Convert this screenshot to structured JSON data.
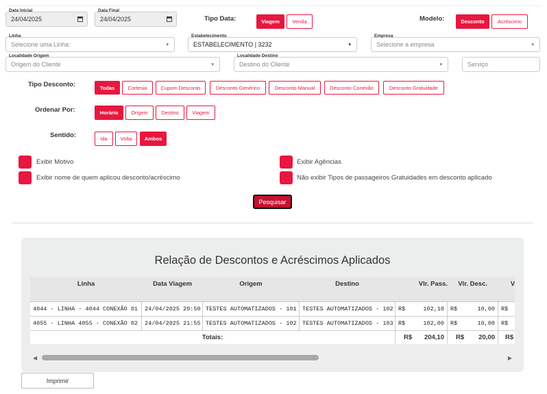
{
  "filters": {
    "data_inicial": {
      "label": "Data Inicial",
      "value": "24/04/2025"
    },
    "data_final": {
      "label": "Data Final",
      "value": "24/04/2025"
    },
    "tipo_data": {
      "label": "Tipo Data:",
      "options": [
        "Viagem",
        "Venda"
      ],
      "selected": "Viagem"
    },
    "modelo": {
      "label": "Modelo:",
      "options": [
        "Desconto",
        "Acréscimo"
      ],
      "selected": "Desconto"
    },
    "linha": {
      "label": "Linha",
      "placeholder": "Selecione uma Linha:"
    },
    "estabelecimento": {
      "label": "Estabelecimento",
      "value": "ESTABELECIMENTO | 3232"
    },
    "empresa": {
      "label": "Empresa",
      "placeholder": "Selecione a empresa"
    },
    "localidade_origem": {
      "label": "Localidade Origem",
      "placeholder": "Origem do Cliente"
    },
    "localidade_destino": {
      "label": "Localidade Destino",
      "placeholder": "Destino do Cliente"
    },
    "servico": {
      "placeholder": "Serviço"
    },
    "tipo_desconto": {
      "label": "Tipo Desconto:",
      "options": [
        "Todas",
        "Cortesia",
        "Cupom Desconto",
        "Desconto Genérico",
        "Desconto Manual",
        "Desconto Conexão",
        "Desconto Gratuidade"
      ],
      "selected": "Todas"
    },
    "ordenar_por": {
      "label": "Ordenar Por:",
      "options": [
        "Horário",
        "Origem",
        "Destino",
        "Viagem"
      ],
      "selected": "Horário"
    },
    "sentido": {
      "label": "Sentido:",
      "options": [
        "Ida",
        "Volta",
        "Ambos"
      ],
      "selected": "Ambos"
    },
    "checkboxes": [
      "Exibir Motivo",
      "Exibir Agências",
      "Exibir nome de quem aplicou desconto/acréscimo",
      "Não exibir Tipos de passageiros Gratuidades em desconto aplicado"
    ],
    "pesquisar": "Pesquisar"
  },
  "report": {
    "title": "Relação de Descontos e Acréscimos Aplicados",
    "columns": [
      "Linha",
      "Data Viagem",
      "Origem",
      "Destino",
      "Vlr. Pass.",
      "Vlr. Desc.",
      "V"
    ],
    "rows": [
      [
        "4044 - LINHA - 4044 CONEXÃO 01",
        "24/04/2025 20:50",
        "TESTES AUTOMATIZADOS - 101",
        "TESTES AUTOMATIZADOS - 102",
        "R$",
        "102,10",
        "R$",
        "10,00",
        "R$"
      ],
      [
        "4055 - LINHA 4055 - CONEXÃO 02",
        "24/04/2025 21:55",
        "TESTES AUTOMATIZADOS - 102",
        "TESTES AUTOMATIZADOS - 103",
        "R$",
        "102,00",
        "R$",
        "10,00",
        "R$"
      ]
    ],
    "totals": {
      "label": "Totais:",
      "cur1": "R$",
      "pass": "204,10",
      "cur2": "R$",
      "desc": "20,00",
      "cur3": "R$"
    }
  },
  "imprimir": "Imprimir",
  "colors": {
    "accent": "#e8173f",
    "dark_accent": "#c4122f"
  }
}
